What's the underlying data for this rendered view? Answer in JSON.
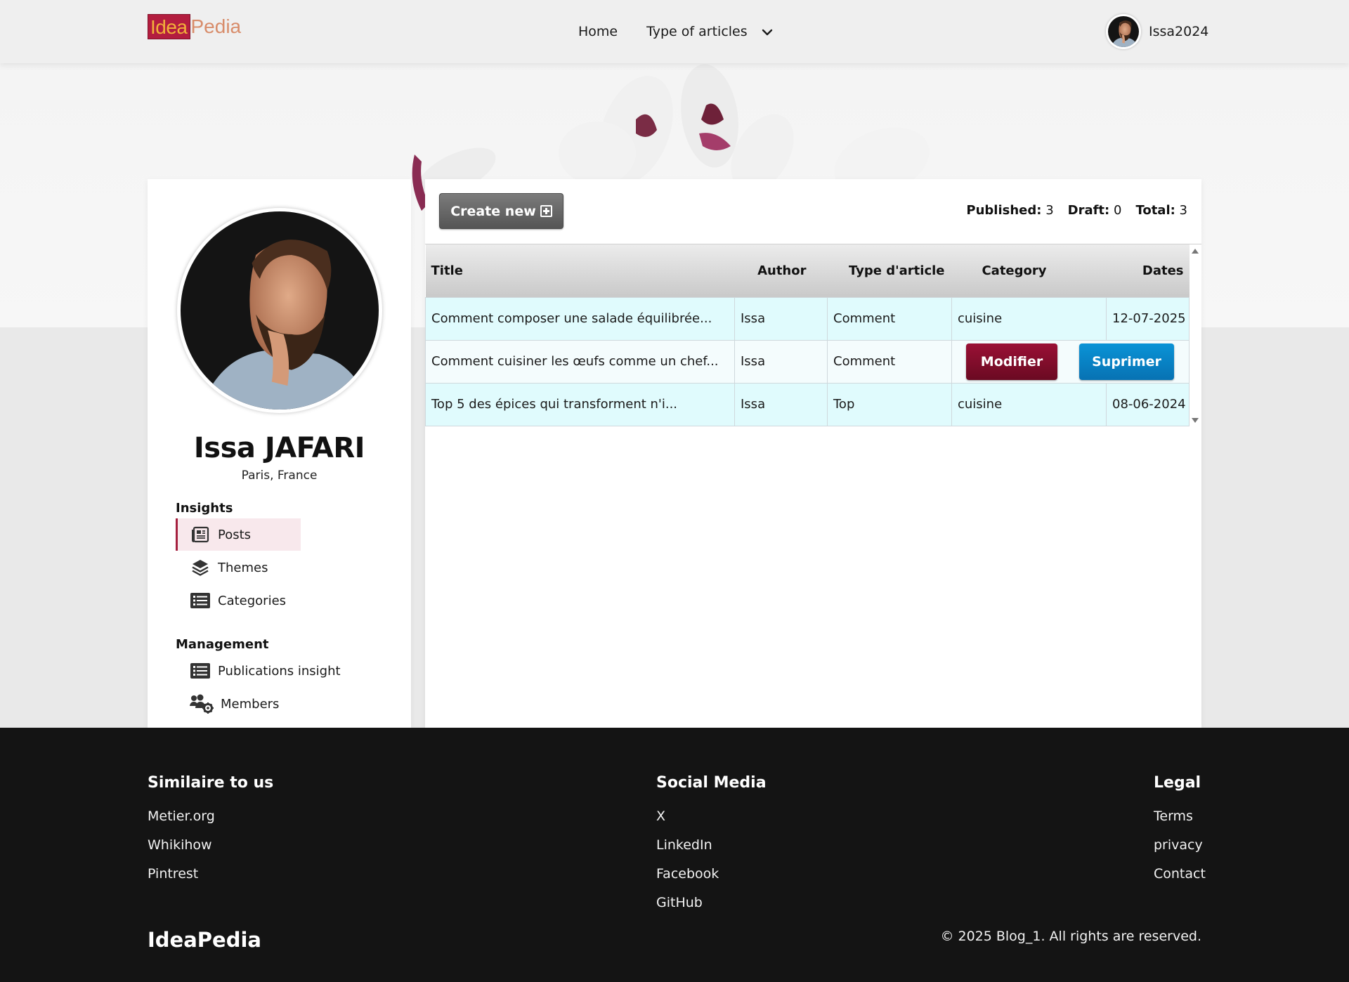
{
  "brand": {
    "logo_part1": "Idea",
    "logo_part2": "Pedia"
  },
  "nav": {
    "home": "Home",
    "type_of_articles": "Type of articles",
    "username": "Issa2024"
  },
  "profile": {
    "name": "Issa JAFARI",
    "location": "Paris, France"
  },
  "sidebar": {
    "insights_title": "Insights",
    "insights_items": [
      {
        "label": "Posts",
        "icon": "newspaper-icon",
        "active": true
      },
      {
        "label": "Themes",
        "icon": "layers-icon",
        "active": false
      },
      {
        "label": "Categories",
        "icon": "list-icon",
        "active": false
      }
    ],
    "management_title": "Management",
    "management_items": [
      {
        "label": "Publications insight",
        "icon": "list-icon"
      },
      {
        "label": "Members",
        "icon": "users-gear-icon"
      }
    ]
  },
  "toolbar": {
    "create_label": "Create new",
    "published_label": "Published:",
    "published_value": "3",
    "draft_label": "Draft:",
    "draft_value": "0",
    "total_label": "Total:",
    "total_value": "3"
  },
  "table": {
    "headers": [
      "Title",
      "Author",
      "Type d'article",
      "Category",
      "Dates"
    ],
    "rows": [
      {
        "title": "Comment composer une salade équilibrée...",
        "author": "Issa",
        "type": "Comment",
        "category": "cuisine",
        "date": "12-07-2025"
      },
      {
        "title": "Comment cuisiner les œufs comme un chef...",
        "author": "Issa",
        "type": "Comment",
        "modify_label": "Modifier",
        "delete_label": "Suprimer"
      },
      {
        "title": "Top 5 des épices qui transforment n'i...",
        "author": "Issa",
        "type": "Top",
        "category": "cuisine",
        "date": "08-06-2024"
      }
    ]
  },
  "footer": {
    "col1_title": "Similaire to us",
    "col1_links": [
      "Metier.org",
      "Whikihow",
      "Pintrest"
    ],
    "col2_title": "Social Media",
    "col2_links": [
      "X",
      "LinkedIn",
      "Facebook",
      "GitHub"
    ],
    "col3_title": "Legal",
    "col3_links": [
      "Terms",
      "privacy",
      "Contact"
    ],
    "brand": "IdeaPedia",
    "copyright": "© 2025 Blog_1. All rights are reserved."
  },
  "colors": {
    "accent": "#a5203f",
    "modify_button": "#8a0e2f",
    "delete_button": "#0a86c9",
    "footer_bg": "#141414",
    "row_highlight": "#e0fbfd"
  }
}
